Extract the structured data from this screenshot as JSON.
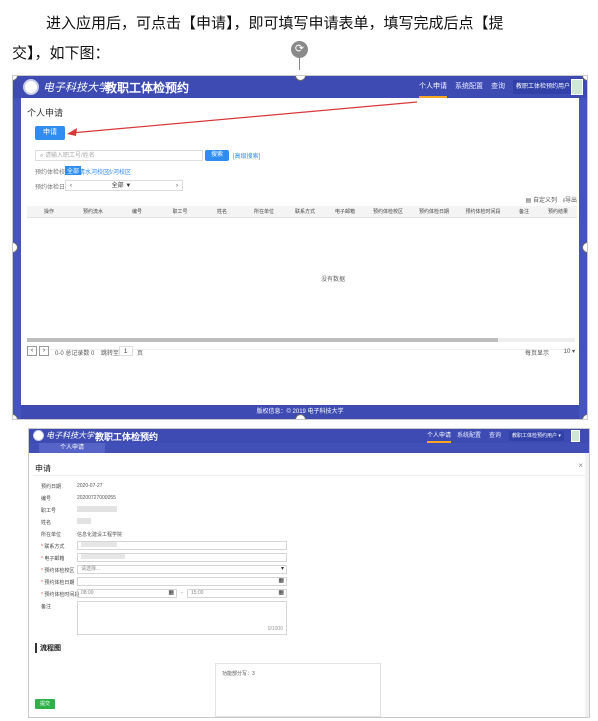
{
  "doc": {
    "line1": "进入应用后，可点击【申请】，即可填写申请表单，填写完成后点【提",
    "line2": "交】，如下图："
  },
  "app": {
    "logo_text": "电子科技大学",
    "title": "教职工体检预约",
    "nav": [
      "个人申请",
      "系统配置",
      "查询"
    ],
    "user_menu": "教职工体检预约用户",
    "colors": {
      "brand": "#3d4bb3",
      "primary_button": "#2f8cf0",
      "annotation_arrow": "#d9373a",
      "submit_button": "#2db24a"
    }
  },
  "list_page": {
    "page_title": "个人申请",
    "apply_button": "申请",
    "search_placeholder": "请输入职工号/姓名",
    "search_button": "搜索",
    "advanced_search": "[高级搜索]",
    "filter_label_1": "预约体检校区",
    "filter_options": [
      "全部",
      "清水河校区",
      "沙河校区"
    ],
    "filter_label_2": "预约体检日期",
    "date_value": "全部 ▼",
    "tool_select_columns": "自定义列",
    "tool_export": "导出",
    "columns": [
      "操作",
      "预约流水",
      "编号",
      "职工号",
      "姓名",
      "所在单位",
      "联系方式",
      "电子邮箱",
      "预约体检校区",
      "预约体检日期",
      "预约体检时间段",
      "备注",
      "预约结果"
    ],
    "empty_text": "没有数据",
    "pager_info": "0-0 总记录数 0",
    "jump_label": "跳转至",
    "jump_value": "1",
    "page_unit": "页",
    "page_size_label": "每页显示",
    "page_size": "10",
    "footer": "版权信息：© 2019 电子科技大学"
  },
  "form_page": {
    "tab": "个人申请",
    "dialog_title": "申请",
    "close": "×",
    "fields": [
      {
        "label": "预约日期",
        "value": "2020-07-27"
      },
      {
        "label": "编号",
        "value": "20200727000055"
      },
      {
        "label": "职工号",
        "value": ""
      },
      {
        "label": "姓名",
        "value": ""
      },
      {
        "label": "所在单位",
        "value": "信息化建设工程学院"
      }
    ],
    "inputs": [
      {
        "label": "联系方式",
        "value": ""
      },
      {
        "label": "电子邮箱",
        "value": ""
      },
      {
        "label": "预约体检校区",
        "value": "请选择..."
      },
      {
        "label": "预约体检日期",
        "value": ""
      }
    ],
    "time_label": "预约体检时间段",
    "time_start": "08:00",
    "time_sep": "-",
    "time_end": "15:00",
    "remark_label": "备注",
    "remark_counter": "0/1000",
    "flow_title": "流程图",
    "flow_node": "功能部分写：3",
    "submit_button": "提交"
  }
}
